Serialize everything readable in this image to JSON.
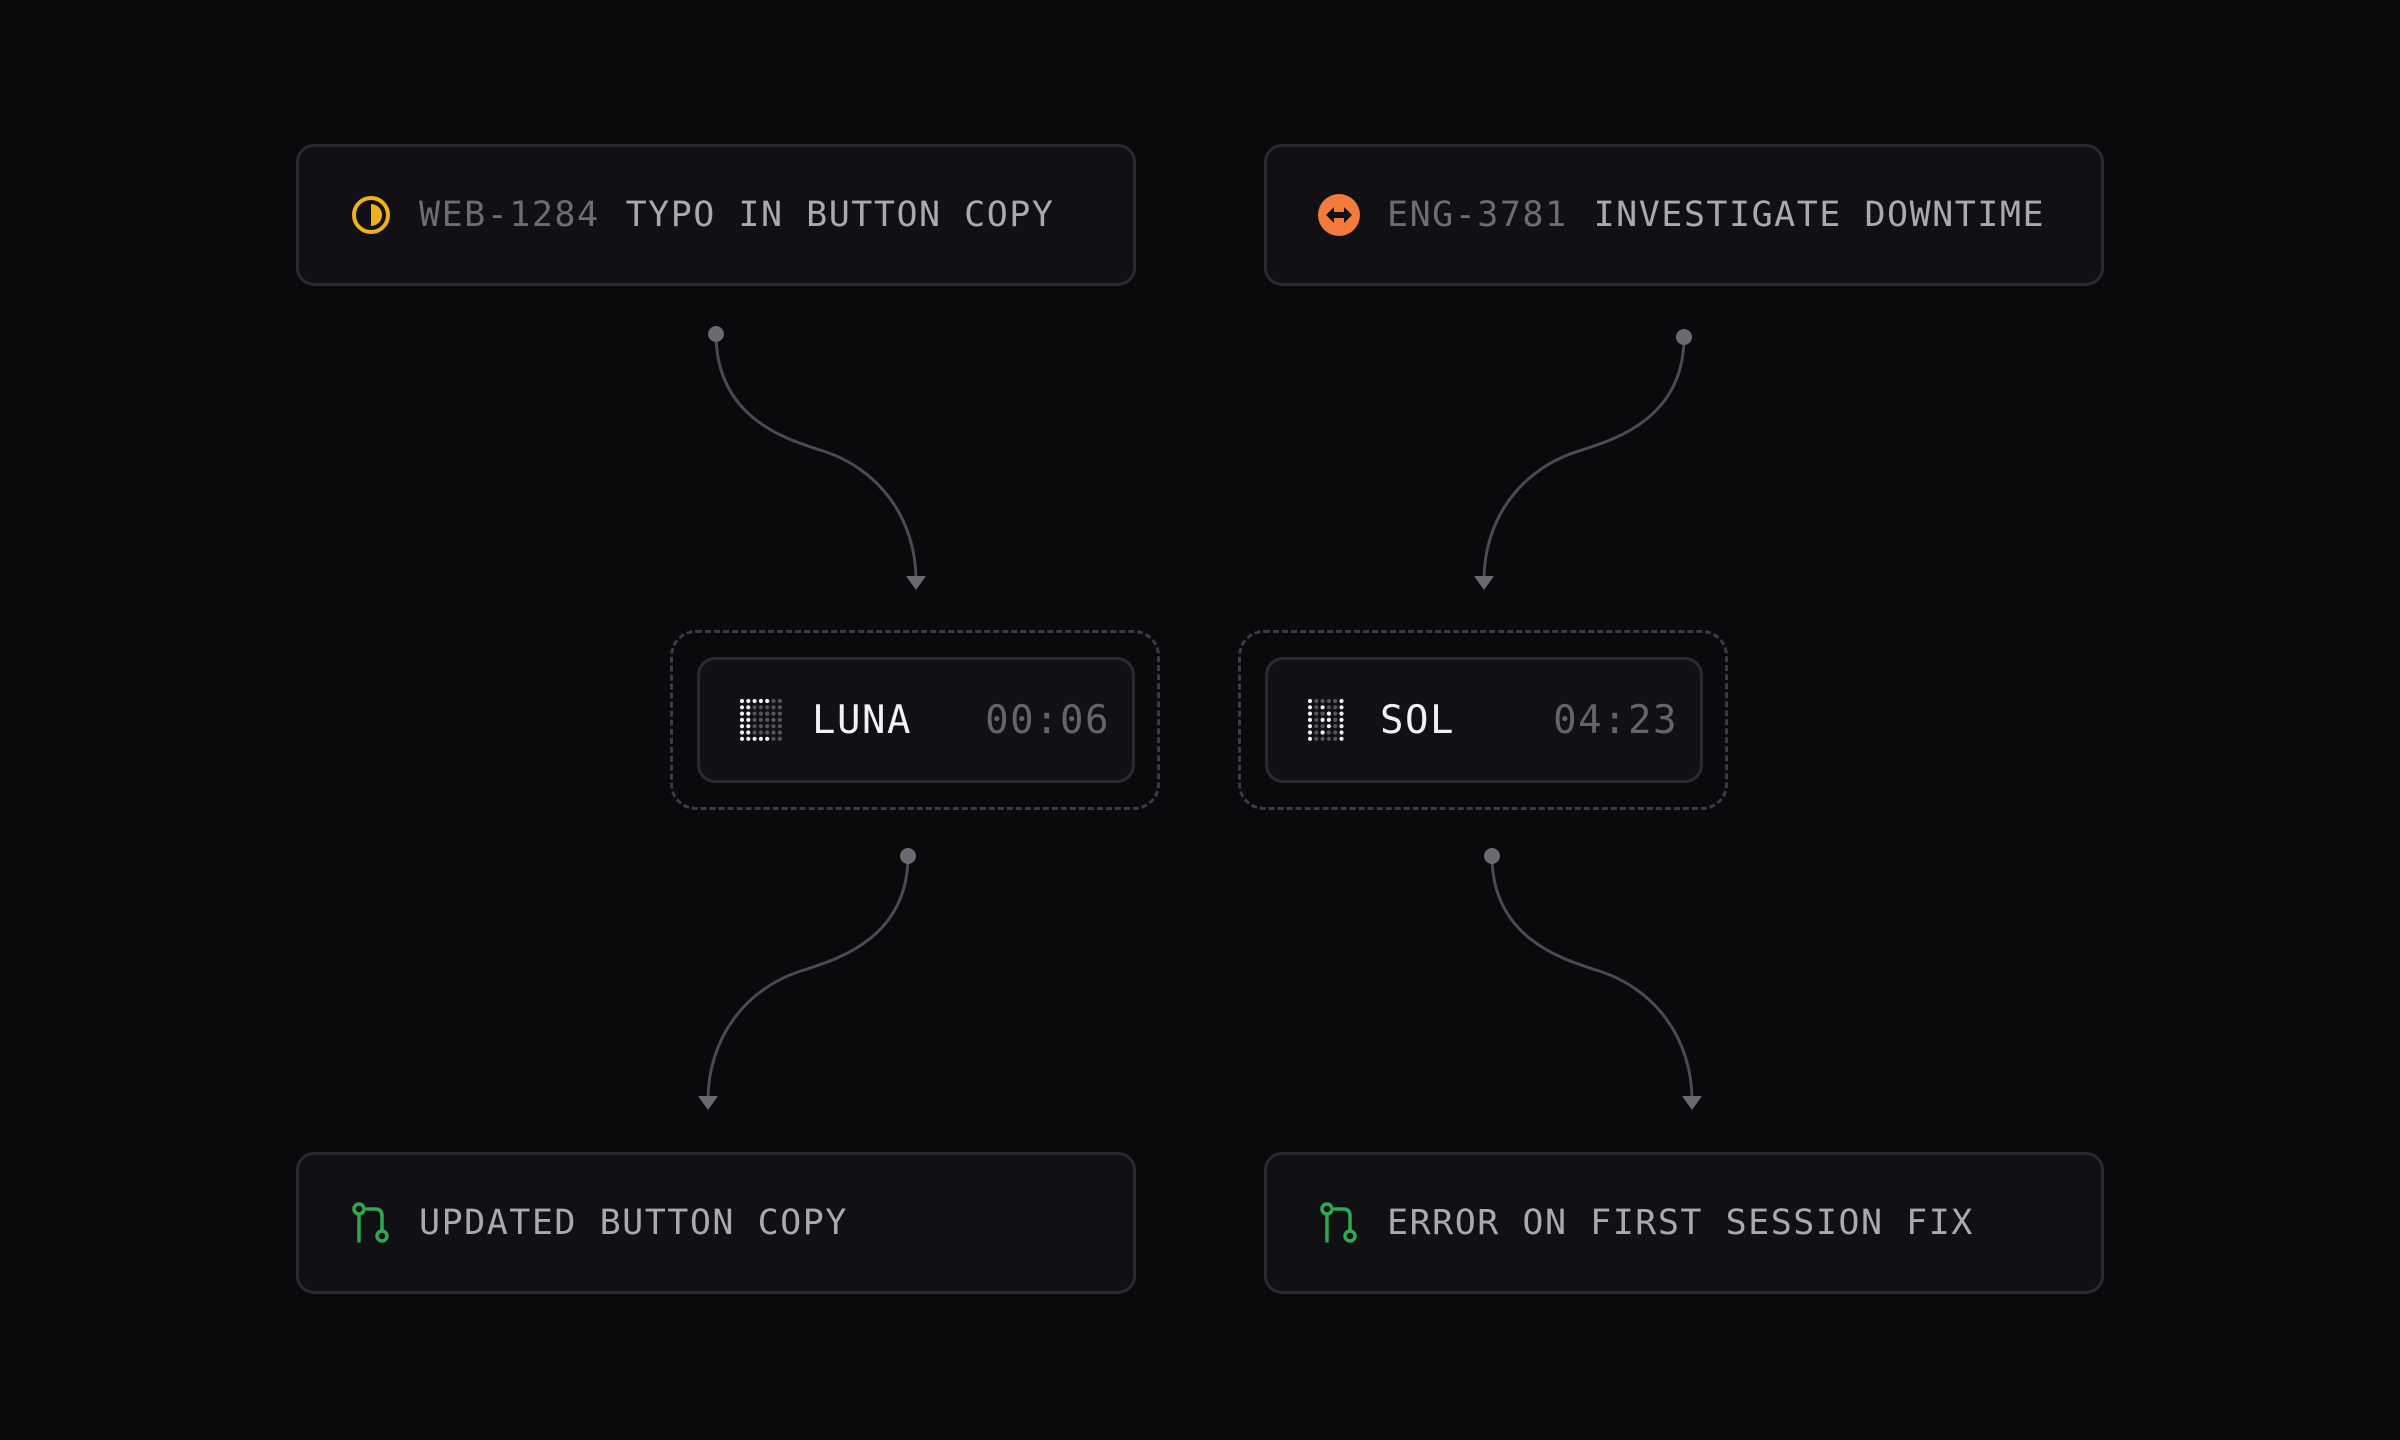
{
  "colors": {
    "background": "#0a0a0d",
    "card": "#111115",
    "border": "#2a2a30",
    "connector": "#4a4a50",
    "in_progress": "#f0b020",
    "urgent": "#f27a3a",
    "merged": "#2fa84f"
  },
  "issues": [
    {
      "code": "WEB-1284",
      "title": "TYPO IN BUTTON COPY",
      "icon": "in-progress-circle-icon"
    },
    {
      "code": "ENG-3781",
      "title": "INVESTIGATE DOWNTIME",
      "icon": "urgent-priority-icon"
    }
  ],
  "agents": [
    {
      "name": "LUNA",
      "time": "00:06",
      "icon": "dot-matrix-l-icon"
    },
    {
      "name": "SOL",
      "time": "04:23",
      "icon": "dot-matrix-s-icon"
    }
  ],
  "pull_requests": [
    {
      "title": "UPDATED BUTTON COPY",
      "icon": "pull-request-icon"
    },
    {
      "title": "ERROR ON FIRST SESSION FIX",
      "icon": "pull-request-icon"
    }
  ]
}
